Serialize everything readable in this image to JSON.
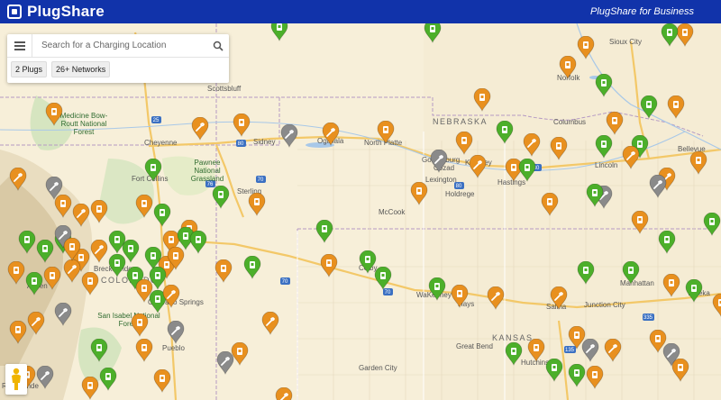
{
  "header": {
    "brand": "PlugShare",
    "business_link": "PlugShare for Business"
  },
  "search": {
    "placeholder": "Search for a Charging Location",
    "value": ""
  },
  "filters": {
    "plugs_label": "2 Plugs",
    "networks_label": "26+ Networks"
  },
  "colors": {
    "header_bg": "#1133aa",
    "pin_orange": "#e8901f",
    "pin_green": "#4caf2a",
    "pin_gray": "#8a8a8a"
  },
  "map": {
    "states": [
      "NEBRASKA",
      "KANSAS",
      "COLORADO"
    ],
    "cities": [
      "Scottsbluff",
      "Sidney",
      "Ogallala",
      "North Platte",
      "Gothenburg",
      "Cozad",
      "Lexington",
      "Kearney",
      "Holdrege",
      "Hastings",
      "Columbus",
      "Norfolk",
      "Sioux City",
      "Lincoln",
      "Bellevue",
      "Cheyenne",
      "Fort Collins",
      "Sterling",
      "McCook",
      "Colby",
      "Hays",
      "WaKeeney",
      "Salina",
      "Junction City",
      "Manhattan",
      "Topeka",
      "Great Bend",
      "Hutchinson",
      "Garden City",
      "Pueblo",
      "Aspen",
      "Breckenridge",
      "Colorado Springs",
      "Rio Grande"
    ],
    "parks": [
      "Medicine Bow-Routt National Forest",
      "Pawnee National Grassland",
      "San Isabel National Forest"
    ],
    "highways": [
      "25",
      "80",
      "76",
      "70",
      "135",
      "335"
    ],
    "pins": [
      {
        "kind": "green",
        "icon": "plug"
      },
      {
        "kind": "green",
        "icon": "plug"
      },
      {
        "kind": "orange",
        "icon": "plug"
      },
      {
        "kind": "green",
        "icon": "plug"
      },
      {
        "kind": "orange",
        "icon": "plug"
      },
      {
        "kind": "orange",
        "icon": "wrench"
      },
      {
        "kind": "orange",
        "icon": "plug"
      },
      {
        "kind": "gray",
        "icon": "wrench"
      },
      {
        "kind": "orange",
        "icon": "wrench"
      },
      {
        "kind": "orange",
        "icon": "plug"
      },
      {
        "kind": "gray",
        "icon": "wrench"
      },
      {
        "kind": "orange",
        "icon": "plug"
      },
      {
        "kind": "green",
        "icon": "plug"
      },
      {
        "kind": "green",
        "icon": "plug"
      },
      {
        "kind": "orange",
        "icon": "plug"
      },
      {
        "kind": "orange",
        "icon": "plug"
      },
      {
        "kind": "green",
        "icon": "plug"
      },
      {
        "kind": "orange",
        "icon": "wrench"
      },
      {
        "kind": "orange",
        "icon": "plug"
      },
      {
        "kind": "green",
        "icon": "plug"
      }
    ]
  }
}
